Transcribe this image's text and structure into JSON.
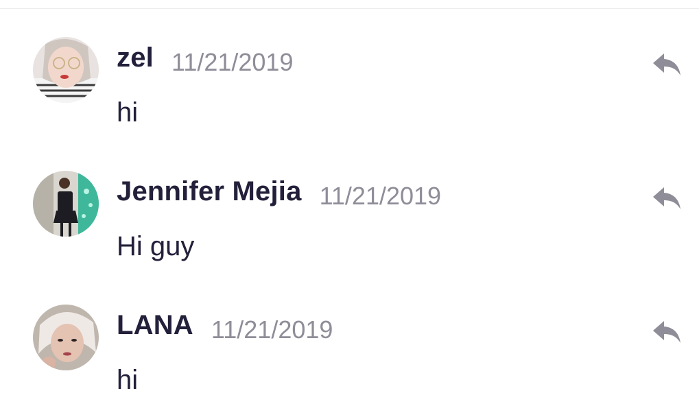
{
  "comments": [
    {
      "author": "zel",
      "date": "11/21/2019",
      "text": "hi",
      "avatar": "avatar-photo",
      "reply_icon": "reply-icon"
    },
    {
      "author": "Jennifer Mejia",
      "date": "11/21/2019",
      "text": "Hi guy",
      "avatar": "avatar-photo",
      "reply_icon": "reply-icon"
    },
    {
      "author": "LANA",
      "date": "11/21/2019",
      "text": "hi",
      "avatar": "avatar-photo",
      "reply_icon": "reply-icon"
    }
  ],
  "colors": {
    "author_text": "#22203a",
    "date_text": "#8e8d98",
    "reply_icon": "#8e8d98",
    "divider": "#ececf0"
  }
}
